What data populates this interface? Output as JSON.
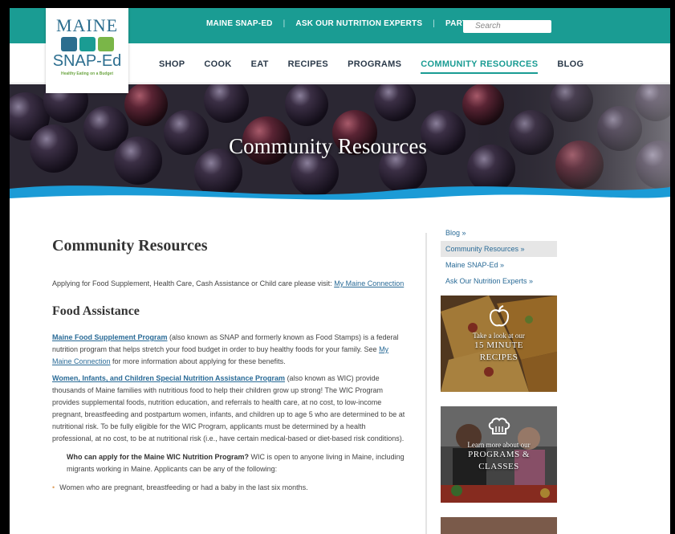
{
  "topbar": {
    "links": [
      "MAINE SNAP-ED",
      "ASK OUR NUTRITION EXPERTS",
      "PARTNERS"
    ],
    "search_placeholder": "Search"
  },
  "logo": {
    "line1": "MAINE",
    "line2": "SNAP-Ed",
    "tagline": "Healthy Eating on a Budget"
  },
  "nav": {
    "items": [
      "SHOP",
      "COOK",
      "EAT",
      "RECIPES",
      "PROGRAMS",
      "COMMUNITY RESOURCES",
      "BLOG"
    ],
    "active": "COMMUNITY RESOURCES"
  },
  "hero": {
    "title": "Community Resources"
  },
  "main": {
    "heading": "Community Resources",
    "intro": "Applying for Food Supplement, Health Care, Cash Assistance or Child care please visit: ",
    "intro_link": "My Maine Connection",
    "food_heading": "Food Assistance",
    "p1_link": "Maine Food Supplement Program",
    "p1_text": " (also known as SNAP and formerly known as Food Stamps) is a federal nutrition program that helps stretch your food budget in order to buy healthy foods for your family. See ",
    "p1_link2": "My Maine Connection",
    "p1_text2": " for more information about applying for these benefits.",
    "p2_link": "Women, Infants, and Children Special Nutrition Assistance Program",
    "p2_text": " (also known as WIC) provide thousands of Maine families with nutritious food to help their children grow up strong! The WIC Program provides supplemental foods, nutrition education, and referrals to health care, at no cost, to low-income pregnant, breastfeeding and postpartum women, infants, and children up to age 5 who are determined to be at nutritional risk. To be fully eligible for the WIC Program, applicants must be determined by a health professional, at no cost, to be at nutritional risk (i.e., have certain medical-based or diet-based risk conditions).",
    "who_bold": "Who can apply for the Maine WIC Nutrition Program?",
    "who_text": " WIC is open to anyone living in Maine, including migrants working in Maine. Applicants can be any of the following:",
    "bullet1": "Women who are pregnant, breastfeeding or had a baby in the last six months."
  },
  "sidebar": {
    "links": [
      "Blog »",
      "Community Resources »",
      "Maine SNAP-Ed »",
      "Ask Our Nutrition Experts »"
    ],
    "active": "Community Resources »",
    "promo1_small": "Take a look at our",
    "promo1_big1": "15 MINUTE",
    "promo1_big2": "RECIPES",
    "promo2_small": "Learn more about our",
    "promo2_big1": "PROGRAMS &",
    "promo2_big2": "CLASSES"
  },
  "colors": {
    "teal": "#1a9c93",
    "link": "#2a6b97",
    "wave": "#1b9bd6"
  }
}
